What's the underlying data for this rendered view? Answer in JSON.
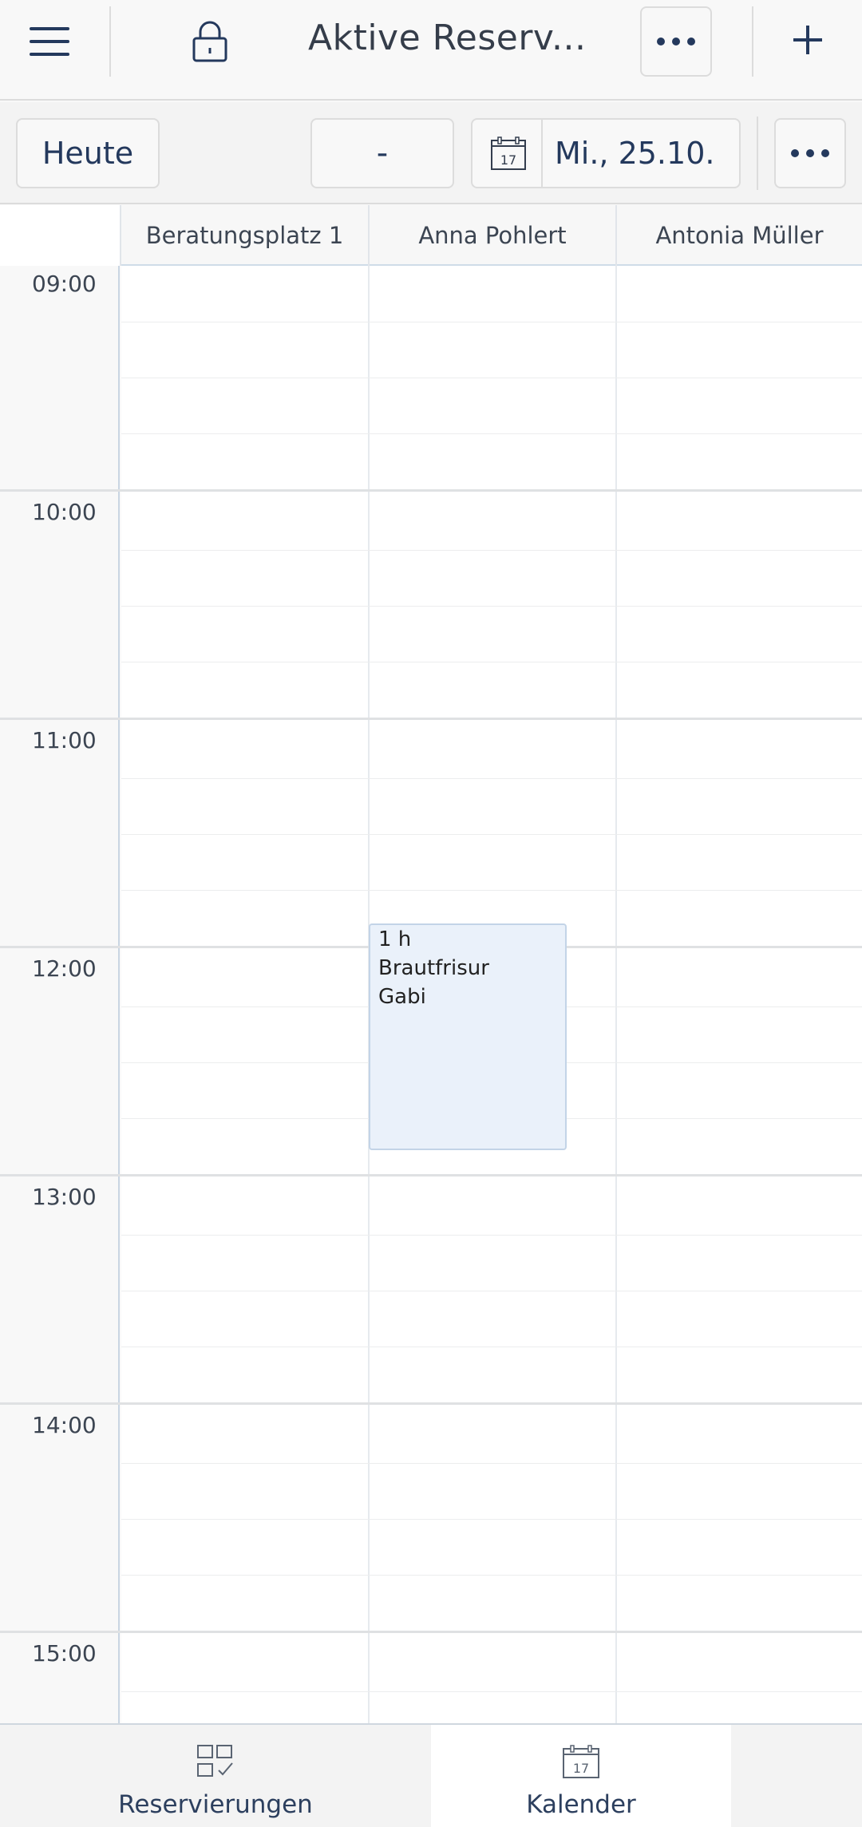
{
  "header": {
    "title": "Aktive Reserv..."
  },
  "toolbar": {
    "today_label": "Heute",
    "prev_label": "-",
    "date_label": "Mi., 25.10.",
    "calendar_day": "17"
  },
  "calendar": {
    "columns": [
      "Beratungsplatz 1",
      "Anna Pohlert",
      "Antonia Müller"
    ],
    "hours": [
      "09:00",
      "10:00",
      "11:00",
      "12:00",
      "13:00",
      "14:00",
      "15:00"
    ],
    "event": {
      "duration": "1 h",
      "service": "Brautfrisur",
      "client": "Gabi"
    }
  },
  "bottom_nav": {
    "reservations_label": "Reservierungen",
    "calendar_label": "Kalender",
    "calendar_day": "17"
  },
  "colors": {
    "accent": "#24395d",
    "event_bg": "#eaf1fa",
    "event_border": "#c3d4e7"
  }
}
